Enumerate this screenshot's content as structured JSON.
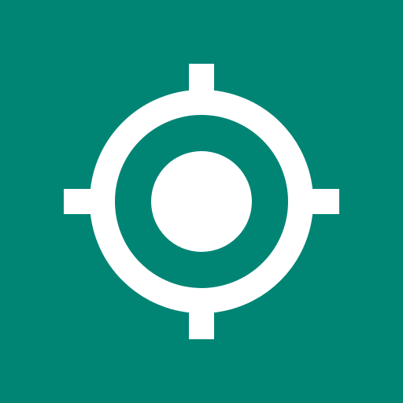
{
  "icon": {
    "name": "location-crosshair-icon",
    "background_color": "#008575",
    "foreground_color": "#FFFFFF"
  }
}
